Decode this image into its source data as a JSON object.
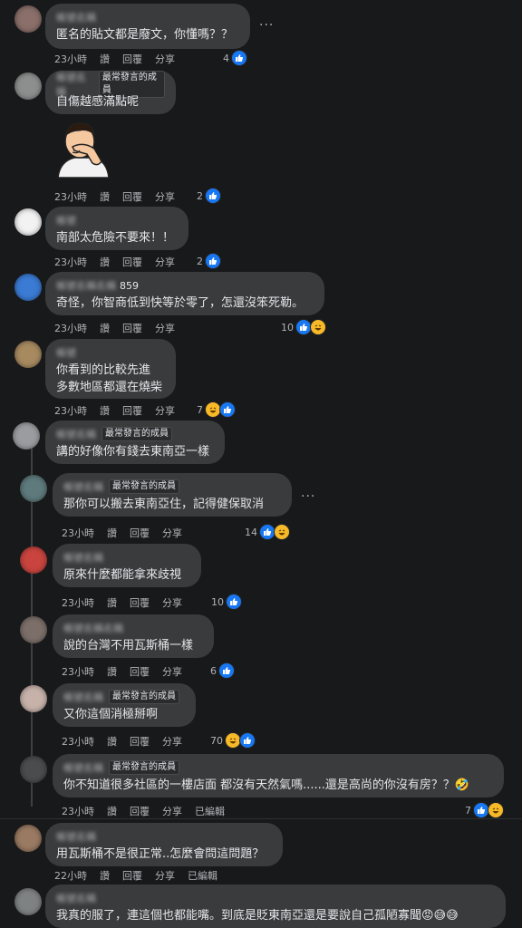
{
  "comments": [
    {
      "name": "帳號名稱",
      "text": [
        "匿名的貼文都是廢文，你懂嗎？？"
      ],
      "time": "23小時",
      "like": "讚",
      "reply": "回覆",
      "share": "分享",
      "count": "4",
      "reactions": [
        "like"
      ]
    },
    {
      "name": "帳號名稱",
      "badge": "最常發言的成員",
      "text": [
        "自傷越感滿點呢"
      ],
      "time": "23小時",
      "like": "讚",
      "reply": "回覆",
      "share": "分享",
      "count": "2",
      "reactions": [
        "like"
      ]
    },
    {
      "name": "帳號",
      "text": [
        "南部太危險不要來！！"
      ],
      "time": "23小時",
      "like": "讚",
      "reply": "回覆",
      "share": "分享",
      "count": "2",
      "reactions": [
        "like"
      ]
    },
    {
      "name": "帳號名稱名稱",
      "name_suffix": "859",
      "text": [
        "奇怪，你智商低到快等於零了，怎還沒笨死勒。"
      ],
      "time": "23小時",
      "like": "讚",
      "reply": "回覆",
      "share": "分享",
      "count": "10",
      "reactions": [
        "like",
        "haha"
      ]
    },
    {
      "name": "帳號",
      "text": [
        "你看到的比較先進",
        "多數地區都還在燒柴"
      ],
      "time": "23小時",
      "like": "讚",
      "reply": "回覆",
      "share": "分享",
      "count": "7",
      "reactions": [
        "haha",
        "like"
      ]
    },
    {
      "name": "帳號名稱",
      "badge": "最常發言的成員",
      "text": [
        "講的好像你有錢去東南亞一樣"
      ]
    },
    {
      "name": "帳號名稱",
      "badge": "最常發言的成員",
      "text": [
        "那你可以搬去東南亞住，記得健保取消"
      ],
      "time": "23小時",
      "like": "讚",
      "reply": "回覆",
      "share": "分享",
      "count": "14",
      "reactions": [
        "like",
        "haha"
      ]
    },
    {
      "name": "帳號名稱",
      "text": [
        "原來什麼都能拿來歧視"
      ],
      "time": "23小時",
      "like": "讚",
      "reply": "回覆",
      "share": "分享",
      "count": "10",
      "reactions": [
        "like"
      ]
    },
    {
      "name": "帳號名稱名稱",
      "text": [
        "說的台灣不用瓦斯桶一樣"
      ],
      "time": "23小時",
      "like": "讚",
      "reply": "回覆",
      "share": "分享",
      "count": "6",
      "reactions": [
        "like"
      ]
    },
    {
      "name": "帳號名稱",
      "badge": "最常發言的成員",
      "text": [
        "又你這個消極掰啊"
      ],
      "time": "23小時",
      "like": "讚",
      "reply": "回覆",
      "share": "分享",
      "count": "70",
      "reactions": [
        "haha",
        "like"
      ]
    },
    {
      "name": "帳號名稱",
      "badge": "最常發言的成員",
      "text": [
        "你不知道很多社區的一樓店面 都沒有天然氣嗎......還是高尚的你沒有房？？🤣"
      ],
      "time": "23小時",
      "like": "讚",
      "reply": "回覆",
      "share": "分享",
      "edited": "已編輯",
      "count": "7",
      "reactions": [
        "like",
        "haha"
      ]
    },
    {
      "name": "帳號名稱",
      "text": [
        "用瓦斯桶不是很正常..怎麼會問這問題？"
      ],
      "time": "22小時",
      "like": "讚",
      "reply": "回覆",
      "share": "分享",
      "edited": "已編輯"
    },
    {
      "name": "帳號名稱",
      "text": [
        "我真的服了，連這個也都能嘴。到底是貶東南亞還是要說自己孤陋寡聞😡😅😅"
      ]
    }
  ],
  "colors": {
    "bg": "#18191a",
    "bubble": "#3a3b3c",
    "like": "#1877f2",
    "haha": "#f7b928"
  }
}
